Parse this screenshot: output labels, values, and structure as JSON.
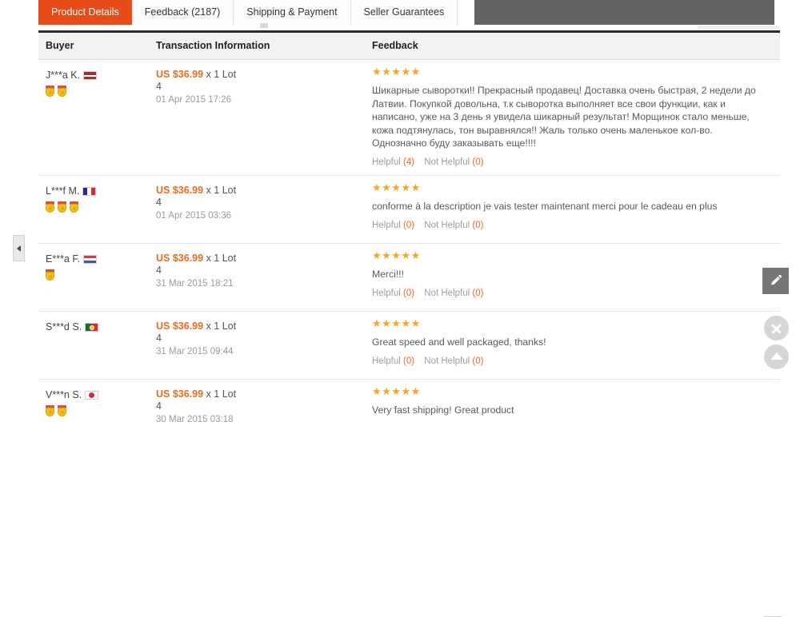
{
  "tabs": [
    {
      "label": "Product Details",
      "active": true
    },
    {
      "label": "Feedback (2187)",
      "active": false
    },
    {
      "label": "Shipping & Payment",
      "active": false
    },
    {
      "label": "Seller Guarantees",
      "active": false
    }
  ],
  "table": {
    "headers": {
      "buyer": "Buyer",
      "transaction": "Transaction Information",
      "feedback": "Feedback"
    },
    "rows": [
      {
        "buyer_name": "J***a K.",
        "flag": "lv",
        "flag_name": "latvia-flag",
        "medals": 2,
        "price": "US $36.99",
        "qty": "x 1 Lot",
        "qty2": "4",
        "date": "01 Apr 2015 17:26",
        "stars": "★★★★★",
        "rating": 5,
        "text": "Шикарные сыворотки!! Прекрасный продавец! Доставка очень быстрая, 2 недели до Латвии. Покупкой довольна, т.к сыворотка выполняет все свои функции, как и написано, уже на 3 день я увидела шикарный результат! Морщинок стало меньше, кожа подтянулась, тон выравнялся!! Жаль только очень маленькое кол-во. Однозначно буду заказывать еще!!!!",
        "helpful_label": "Helpful",
        "helpful_count": "(4)",
        "not_helpful_label": "Not Helpful",
        "not_helpful_count": "(0)"
      },
      {
        "buyer_name": "L***f M.",
        "flag": "fr",
        "flag_name": "france-flag",
        "medals": 3,
        "price": "US $36.99",
        "qty": "x 1 Lot",
        "qty2": "4",
        "date": "01 Apr 2015 03:36",
        "stars": "★★★★★",
        "rating": 5,
        "text": "conforme à la description je vais tester maintenant merci pour le cadeau en plus",
        "helpful_label": "Helpful",
        "helpful_count": "(0)",
        "not_helpful_label": "Not Helpful",
        "not_helpful_count": "(0)"
      },
      {
        "buyer_name": "E***a F.",
        "flag": "nl",
        "flag_name": "netherlands-flag",
        "medals": 1,
        "price": "US $36.99",
        "qty": "x 1 Lot",
        "qty2": "4",
        "date": "31 Mar 2015 18:21",
        "stars": "★★★★★",
        "rating": 5,
        "text": "Merci!!!",
        "helpful_label": "Helpful",
        "helpful_count": "(0)",
        "not_helpful_label": "Not Helpful",
        "not_helpful_count": "(0)"
      },
      {
        "buyer_name": "S***d S.",
        "flag": "pt",
        "flag_name": "portugal-flag",
        "medals": 0,
        "price": "US $36.99",
        "qty": "x 1 Lot",
        "qty2": "4",
        "date": "31 Mar 2015 09:44",
        "stars": "★★★★★",
        "rating": 5,
        "text": "Great speed and well packaged, thanks!",
        "helpful_label": "Helpful",
        "helpful_count": "(0)",
        "not_helpful_label": "Not Helpful",
        "not_helpful_count": "(0)"
      },
      {
        "buyer_name": "V***n S.",
        "flag": "jp",
        "flag_name": "japan-flag",
        "medals": 2,
        "price": "US $36.99",
        "qty": "x 1 Lot",
        "qty2": "4",
        "date": "30 Mar 2015 03:18",
        "stars": "★★★★★",
        "rating": 5,
        "text": "Very fast shipping! Great product",
        "helpful_label": "",
        "helpful_count": "",
        "not_helpful_label": "",
        "not_helpful_count": ""
      }
    ]
  },
  "floating": {
    "edit_icon": "pencil-icon",
    "close_icon": "close-icon",
    "scroll_top_icon": "chevron-up-icon",
    "collapse_icon": "collapse-left-icon"
  },
  "colors": {
    "accent": "#e74c18",
    "price": "#ef6a1f",
    "star": "#f5a623",
    "tab_filler": "#636363",
    "header_bg": "#f2f2f2"
  }
}
